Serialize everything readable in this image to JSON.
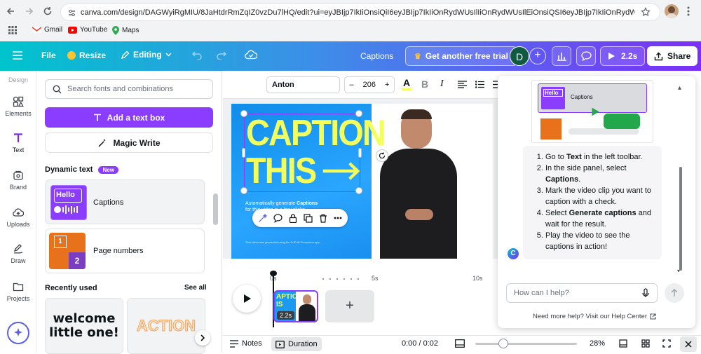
{
  "browser": {
    "url": "canva.com/design/DAGWyiRgMIU/8JaHtdrRmZqIZ0vzDu7lHQ/edit?ui=eyJBIjp7IkIiOnsiQiI6eyJBIjp7IkIiOnRydWUsIlIiOnRydWUsIlEiOnsiQSI6eyJBIjp7IkIiOnRydWV9fX19",
    "bookmarks": [
      "Gmail",
      "YouTube",
      "Maps"
    ]
  },
  "header": {
    "file": "File",
    "resize": "Resize",
    "editing": "Editing",
    "design_title": "Captions",
    "promo": "Get another free trial",
    "avatar": "D",
    "play_time": "2.2s",
    "share": "Share"
  },
  "rail": {
    "items": [
      {
        "label": "Design"
      },
      {
        "label": "Elements"
      },
      {
        "label": "Text"
      },
      {
        "label": "Brand"
      },
      {
        "label": "Uploads"
      },
      {
        "label": "Draw"
      },
      {
        "label": "Projects"
      }
    ]
  },
  "panel": {
    "search_placeholder": "Search fonts and combinations",
    "add_text": "Add a text box",
    "magic_write": "Magic Write",
    "dynamic_heading": "Dynamic text",
    "new_badge": "New",
    "captions_label": "Captions",
    "page_numbers_label": "Page numbers",
    "hello_thumb": "Hello",
    "page_num_digit": "2",
    "recently_used": "Recently used",
    "see_all": "See all",
    "recent_1": "welcome little one!",
    "recent_2": "ACTION"
  },
  "toolbar": {
    "font": "Anton",
    "minus": "–",
    "size": "206",
    "plus": "+",
    "color_a": "A",
    "bold": "B",
    "italic": "I"
  },
  "canvas": {
    "title_line1": "CAPTION",
    "title_line2": "THIS",
    "subtitle_pre": "Automatically generate ",
    "subtitle_bold": "Captions",
    "subtitle_post": "for this video in a few clicks",
    "footnote": "*This video was generated using the D-ID AI Presenters app."
  },
  "timeline": {
    "tick_0": "0s",
    "tick_5": "5s",
    "tick_10": "10s",
    "clip_duration": "2.2s",
    "clip_text": "APTION IS",
    "add": "+"
  },
  "bottom": {
    "notes": "Notes",
    "duration": "Duration",
    "time": "0:00 / 0:02",
    "zoom": "28%"
  },
  "help": {
    "preview_captions": "Captions",
    "preview_hello": "Hello",
    "steps": [
      {
        "pre": "Go to ",
        "bold": "Text",
        "post": " in the left toolbar."
      },
      {
        "pre": "In the side panel, select ",
        "bold": "Captions",
        "post": "."
      },
      {
        "pre": "Mark the video clip you want to caption with a check.",
        "bold": "",
        "post": ""
      },
      {
        "pre": "Select ",
        "bold": "Generate captions",
        "post": " and wait for the result."
      },
      {
        "pre": "Play the video to see the captions in action!",
        "bold": "",
        "post": ""
      }
    ],
    "input_placeholder": "How can I help?",
    "footer": "Need more help? Visit our Help Center",
    "assistant_letter": "C"
  },
  "colors": {
    "accent_purple": "#8b3dff",
    "caption_yellow": "#f3ff5b",
    "canvas_blue": "#1b9af0"
  }
}
